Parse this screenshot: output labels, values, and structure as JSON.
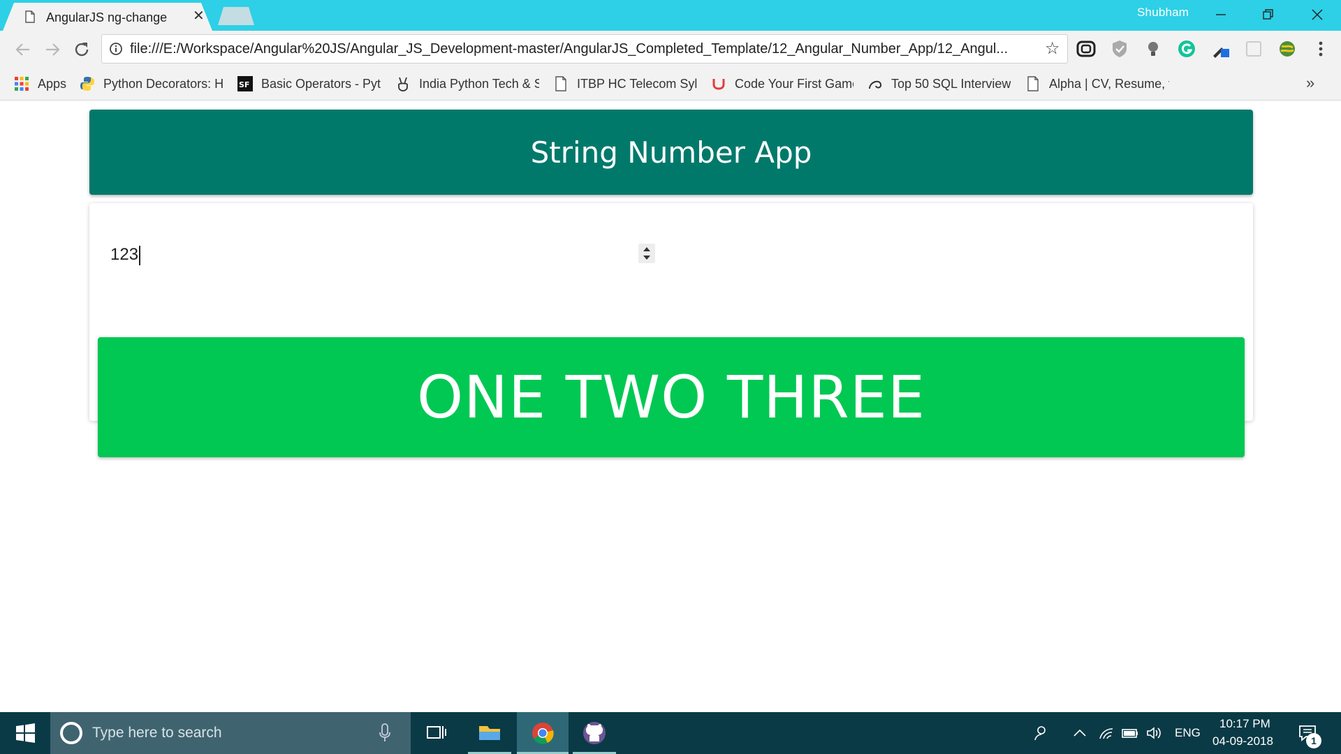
{
  "browser": {
    "tab_title": "AngularJS ng-change",
    "tab_close": "✕",
    "profile_name": "Shubham",
    "url": "file:///E:/Workspace/Angular%20JS/Angular_JS_Development-master/AngularJS_Completed_Template/12_Angular_Number_App/12_Angul...",
    "bookmarks": [
      {
        "label": "Apps",
        "icon": "apps-grid-icon"
      },
      {
        "label": "Python Decorators: H",
        "icon": "python-icon"
      },
      {
        "label": "Basic Operators - Pyt",
        "icon": "sf-icon"
      },
      {
        "label": "India Python Tech & S",
        "icon": "victory-hand-icon"
      },
      {
        "label": "ITBP HC Telecom Sylla",
        "icon": "page-icon"
      },
      {
        "label": "Code Your First Game",
        "icon": "udemy-icon"
      },
      {
        "label": "Top 50 SQL Interview",
        "icon": "swirl-icon"
      },
      {
        "label": "Alpha | CV, Resume, v",
        "icon": "page-icon"
      }
    ],
    "bookmarks_more": "»"
  },
  "app": {
    "header_title": "String Number App",
    "number_input_value": "123",
    "result_text": "ONE TWO THREE",
    "colors": {
      "header": "#00796b",
      "result": "#00c853",
      "input_underline": "#3f7fe0"
    }
  },
  "taskbar": {
    "search_placeholder": "Type here to search",
    "language": "ENG",
    "time": "10:17 PM",
    "date": "04-09-2018",
    "notification_count": "1"
  }
}
